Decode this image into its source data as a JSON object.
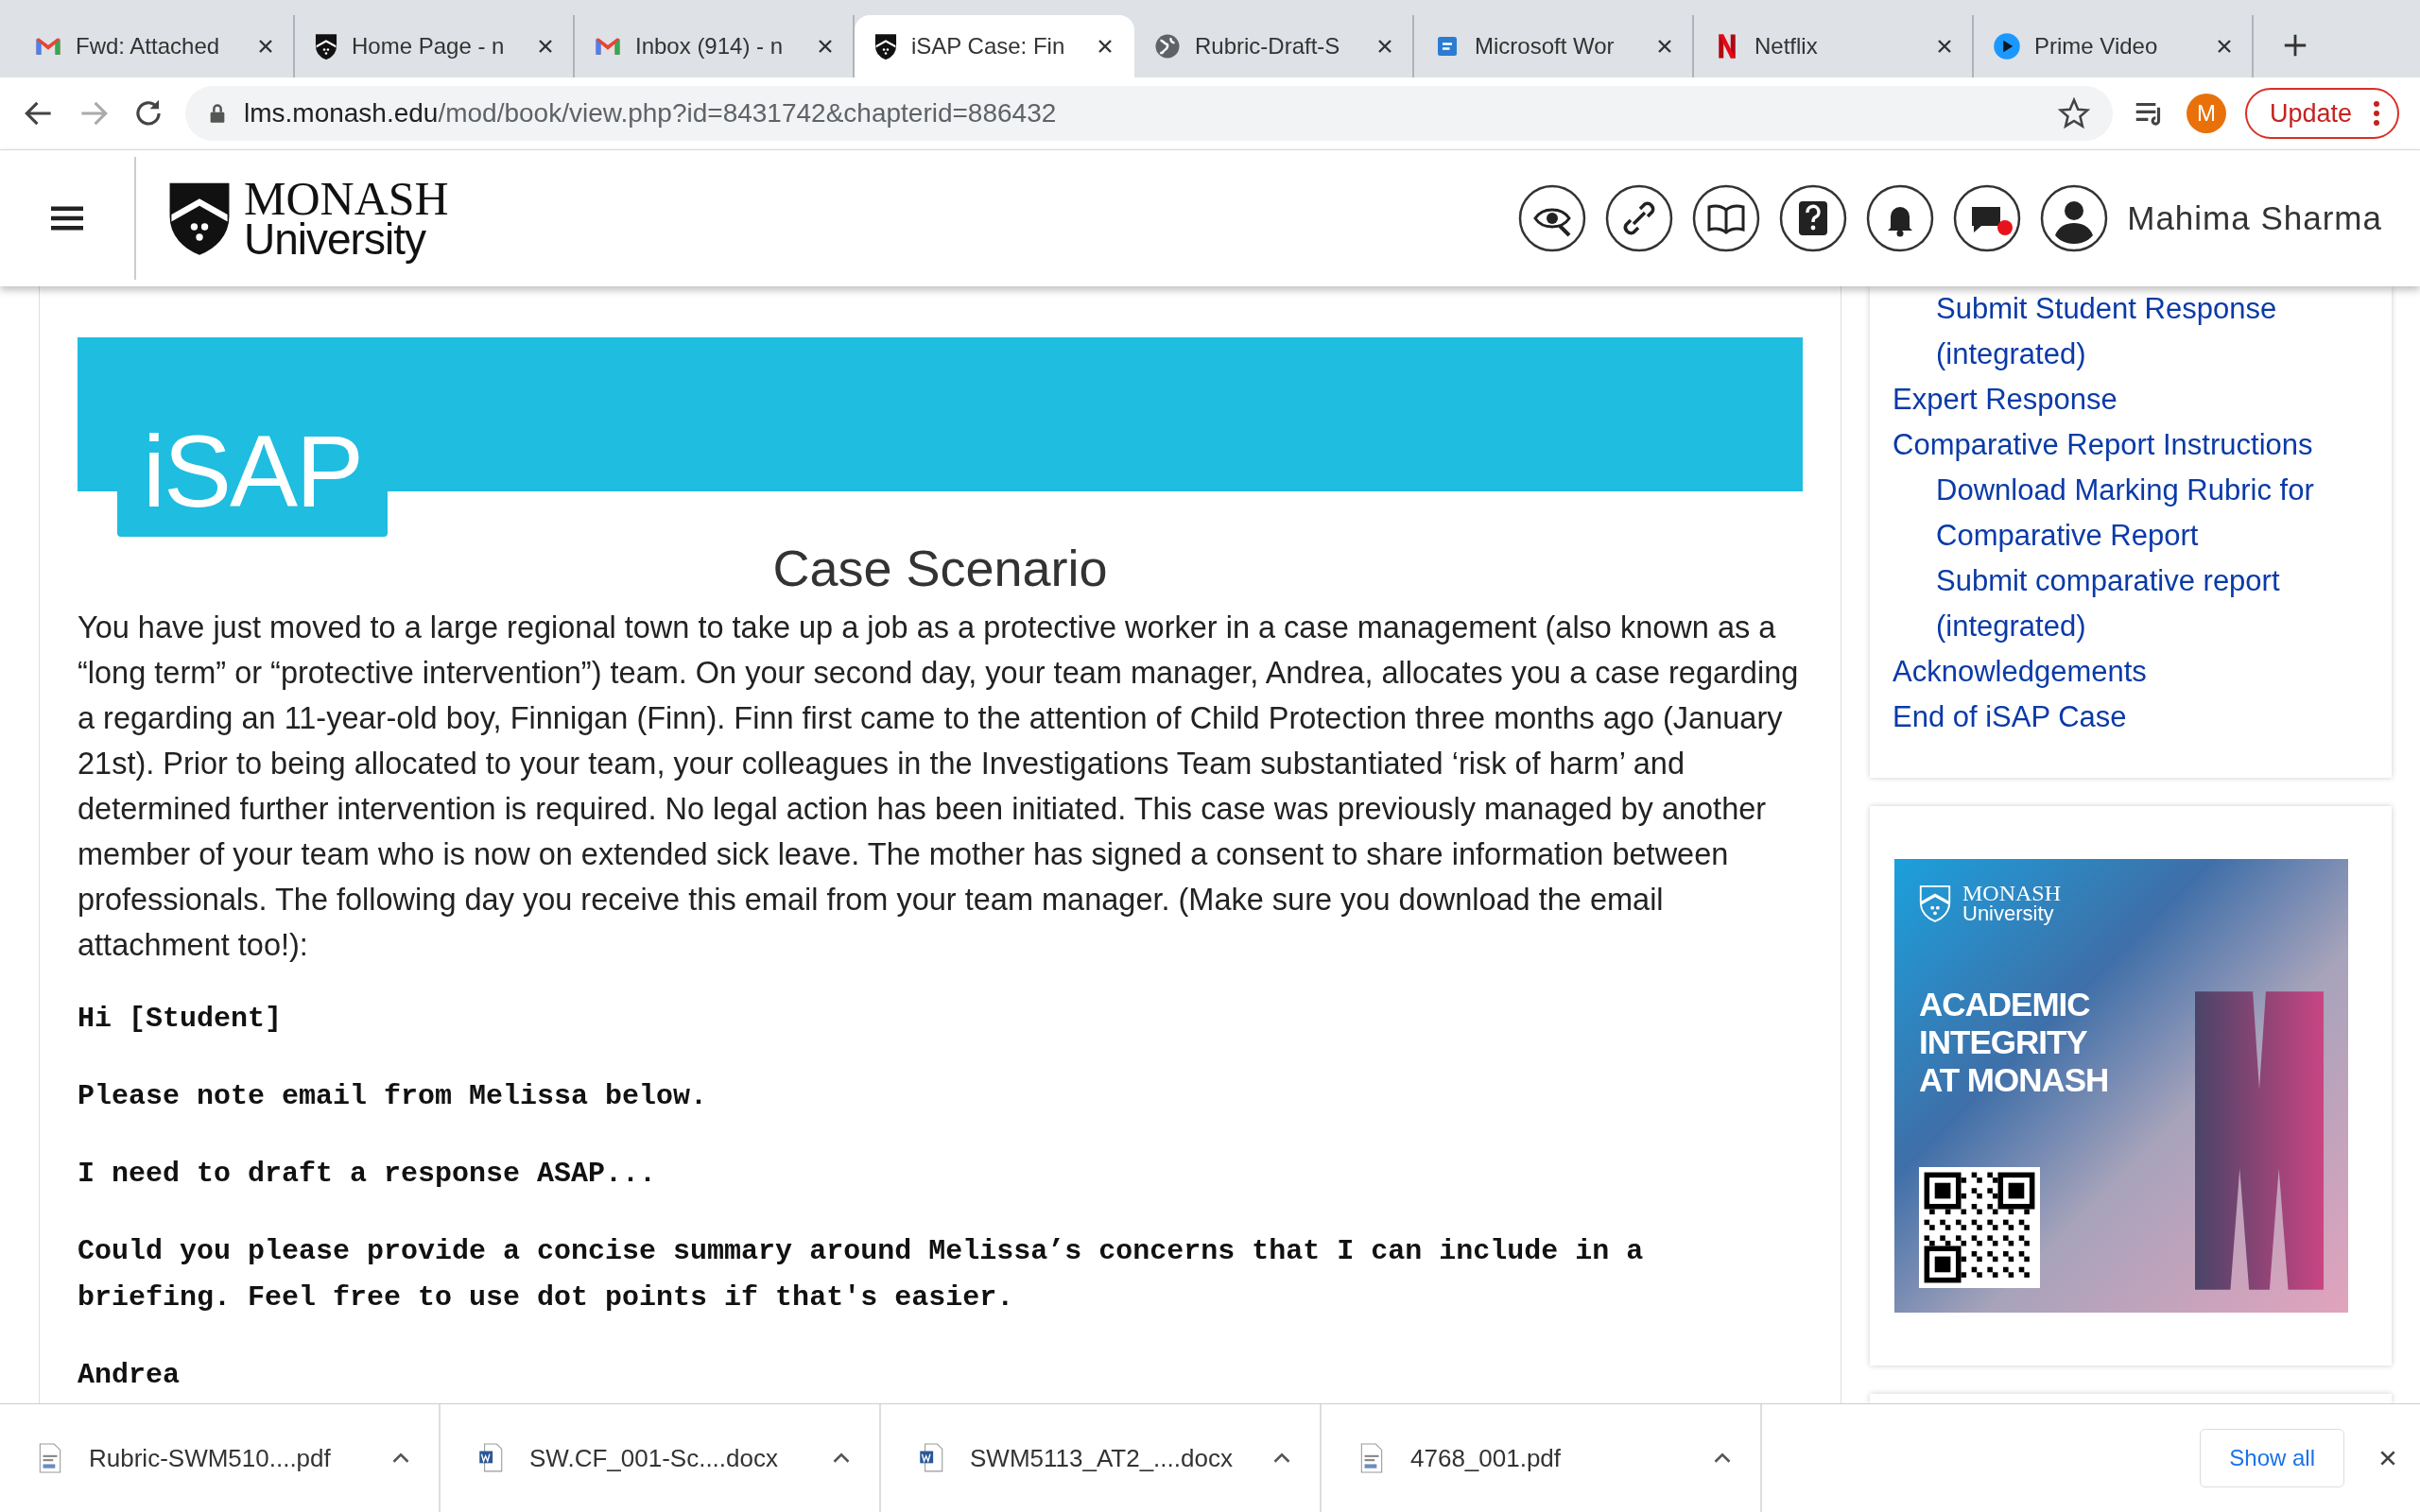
{
  "tabs": [
    {
      "title": "Fwd: Attached",
      "kind": "gmail",
      "selected": false
    },
    {
      "title": "Home Page - n",
      "kind": "crest",
      "selected": false
    },
    {
      "title": "Inbox (914) - n",
      "kind": "gmail",
      "selected": false
    },
    {
      "title": "iSAP Case: Fin",
      "kind": "crest",
      "selected": true
    },
    {
      "title": "Rubric-Draft-S",
      "kind": "globe",
      "selected": false
    },
    {
      "title": "Microsoft Wor",
      "kind": "word",
      "selected": false
    },
    {
      "title": "Netflix",
      "kind": "netflix",
      "selected": false
    },
    {
      "title": "Prime Video",
      "kind": "prime",
      "selected": false
    }
  ],
  "address_bar": {
    "host": "lms.monash.edu",
    "path": "/mod/book/view.php?id=8431742&chapterid=886432"
  },
  "profile_initial": "M",
  "update_button": "Update",
  "site_header": {
    "logo_line1": "MONASH",
    "logo_line2": "University",
    "user_name": "Mahima Sharma",
    "chat_unread": true
  },
  "banner": {
    "logo_text": "iSAP"
  },
  "content": {
    "heading": "Case Scenario",
    "paragraph": "You have just moved to a large regional town to take up a job as a protective worker in a case management (also known as a “long term” or “protective intervention”) team. On your second day, your team manager, Andrea, allocates you a case regarding a regarding an 11-year-old boy, Finnigan (Finn). Finn first came to the attention of Child Protection three months ago (January 21st). Prior to being allocated to your team, your colleagues in the Investigations Team substantiated ‘risk of harm’ and determined further intervention is required. No legal action has been initiated. This case was previously managed by another member of your team who is now on extended sick leave. The mother has signed a consent to share information between professionals. The following day you receive this email from your team manager. (Make sure you download the email attachment too!):",
    "email": [
      "Hi [Student]",
      "Please note email from Melissa below.",
      "I need to draft a response ASAP...",
      "Could you please provide a concise summary around Melissa’s concerns that I can include in a briefing. Feel free to use dot points if that's easier.",
      "Andrea"
    ]
  },
  "sidebar": {
    "toc": [
      {
        "children": [
          {
            "label": "Submit Student Response (integrated)"
          }
        ]
      },
      {
        "label": "Expert Response"
      },
      {
        "label": "Comparative Report Instructions",
        "children": [
          {
            "label": "Download Marking Rubric for Comparative Report"
          },
          {
            "label": "Submit comparative report (integrated)"
          }
        ]
      },
      {
        "label": "Acknowledgements"
      },
      {
        "label": "End of iSAP Case"
      }
    ],
    "promo": {
      "logo_line1": "MONASH",
      "logo_line2": "University",
      "headline": [
        "ACADEMIC",
        "INTEGRITY",
        "AT MONASH"
      ]
    }
  },
  "downloads": [
    {
      "name": "Rubric-SWM510....pdf",
      "kind": "pdf"
    },
    {
      "name": "SW.CF_001-Sc....docx",
      "kind": "docx"
    },
    {
      "name": "SWM5113_AT2_....docx",
      "kind": "docx"
    },
    {
      "name": "4768_001.pdf",
      "kind": "pdf"
    }
  ],
  "show_all": "Show all"
}
